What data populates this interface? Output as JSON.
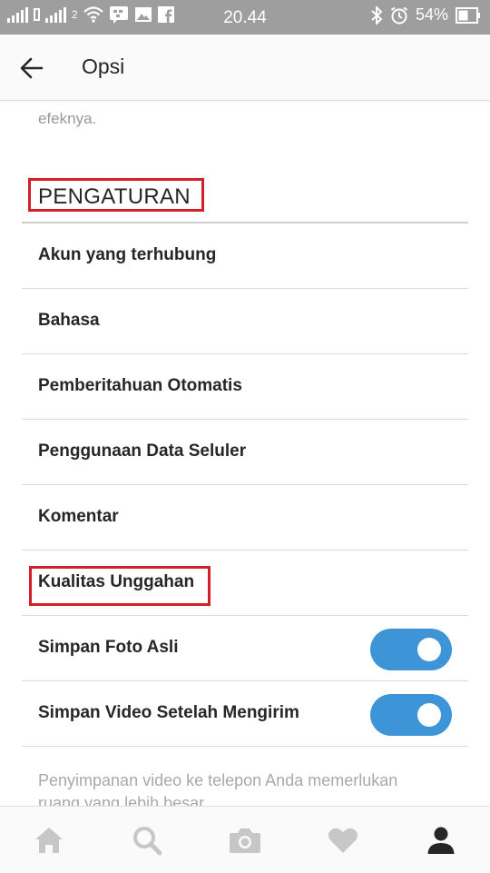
{
  "status_bar": {
    "time": "20.44",
    "battery": "54%",
    "carrier2_label": "2"
  },
  "header": {
    "title": "Opsi"
  },
  "content": {
    "truncated_text": "efeknya.",
    "section_title": "PENGATURAN",
    "items": [
      {
        "label": "Akun yang terhubung"
      },
      {
        "label": "Bahasa"
      },
      {
        "label": "Pemberitahuan Otomatis"
      },
      {
        "label": "Penggunaan Data Seluler"
      },
      {
        "label": "Komentar"
      },
      {
        "label": "Kualitas Unggahan"
      }
    ],
    "toggles": [
      {
        "label": "Simpan Foto Asli",
        "on": true
      },
      {
        "label": "Simpan Video Setelah Mengirim",
        "on": true
      }
    ],
    "note": "Penyimpanan video ke telepon Anda memerlukan ruang yang lebih besar."
  },
  "colors": {
    "highlight_box": "#d32029",
    "toggle_on": "#3d95d8",
    "status_bar": "#9e9e9e"
  },
  "bottom_nav": {
    "icons": [
      "home-icon",
      "search-icon",
      "camera-icon",
      "heart-icon",
      "profile-icon"
    ],
    "active": "profile-icon"
  }
}
